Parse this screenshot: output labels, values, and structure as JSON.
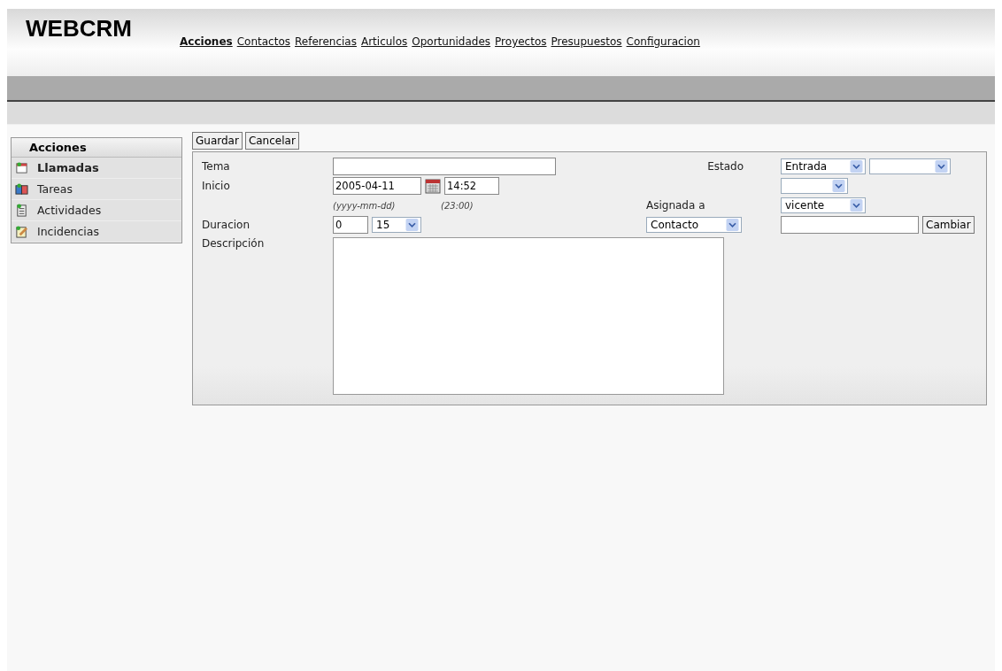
{
  "app": {
    "title": "WEBCRM"
  },
  "nav": [
    {
      "label": "Acciones",
      "selected": true
    },
    {
      "label": "Contactos",
      "selected": false
    },
    {
      "label": "Referencias",
      "selected": false
    },
    {
      "label": "Articulos",
      "selected": false
    },
    {
      "label": "Oportunidades",
      "selected": false
    },
    {
      "label": "Proyectos",
      "selected": false
    },
    {
      "label": "Presupuestos",
      "selected": false
    },
    {
      "label": "Configuracion",
      "selected": false
    }
  ],
  "sidebar": {
    "title": "Acciones",
    "items": [
      {
        "label": "Llamadas",
        "selected": true
      },
      {
        "label": "Tareas",
        "selected": false
      },
      {
        "label": "Actividades",
        "selected": false
      },
      {
        "label": "Incidencias",
        "selected": false
      }
    ]
  },
  "toolbar": [
    "Guardar",
    "Cancelar"
  ],
  "form": {
    "tema": {
      "label": "Tema"
    },
    "inicio": {
      "label": "Inicio",
      "date": "2005-04-11",
      "time": "14:52",
      "date_hint": "(yyyy-mm-dd)",
      "time_hint": "(23:00)"
    },
    "duracion": {
      "label": "Duracion",
      "hours": "0",
      "minutes": "15"
    },
    "descripcion": {
      "label": "Descripción"
    },
    "estado": {
      "label": "Estado",
      "value": "Entrada"
    },
    "asignada": {
      "label": "Asignada a",
      "value": "vicente",
      "type": "Contacto",
      "button": "Cambiar"
    }
  }
}
